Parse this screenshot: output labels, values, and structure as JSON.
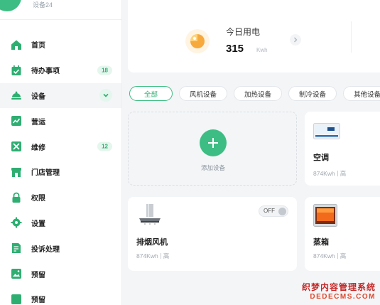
{
  "profile": {
    "subtitle": "设备24"
  },
  "nav": {
    "items": [
      {
        "label": "首页",
        "icon": "home-icon"
      },
      {
        "label": "待办事项",
        "icon": "calendar-check-icon",
        "badge": "18"
      },
      {
        "label": "设备",
        "icon": "bell-device-icon",
        "active": true,
        "expand": "chevron-down-icon"
      },
      {
        "label": "营运",
        "icon": "chart-line-icon"
      },
      {
        "label": "维修",
        "icon": "tools-icon",
        "badge": "12"
      },
      {
        "label": "门店管理",
        "icon": "store-icon"
      },
      {
        "label": "权限",
        "icon": "lock-icon"
      },
      {
        "label": "设置",
        "icon": "gear-icon"
      },
      {
        "label": "投诉处理",
        "icon": "complaint-icon"
      },
      {
        "label": "预留",
        "icon": "image-icon"
      },
      {
        "label": "预留",
        "icon": "partial-icon"
      }
    ]
  },
  "energy": {
    "title": "今日用电",
    "value": "315",
    "unit": "Kwh"
  },
  "tabs": [
    "全部",
    "风机设备",
    "加热设备",
    "制冷设备",
    "其他设备"
  ],
  "add_device": {
    "label": "添加设备"
  },
  "devices": [
    {
      "name": "空调",
      "power": "874Kwh",
      "level": "高",
      "icon": "air-conditioner-icon"
    },
    {
      "name": "排烟风机",
      "power": "874Kwh",
      "level": "高",
      "icon": "range-hood-icon",
      "toggle": "OFF"
    },
    {
      "name": "蒸箱",
      "power": "874Kwh",
      "level": "高",
      "icon": "steam-oven-icon"
    }
  ],
  "watermark": {
    "cn": "织梦内容管理系统",
    "en": "DEDECMS.COM"
  },
  "colors": {
    "accent": "#3dbd83",
    "accent_light": "#e4f6ed",
    "energy_orange": "#f7a93b"
  }
}
